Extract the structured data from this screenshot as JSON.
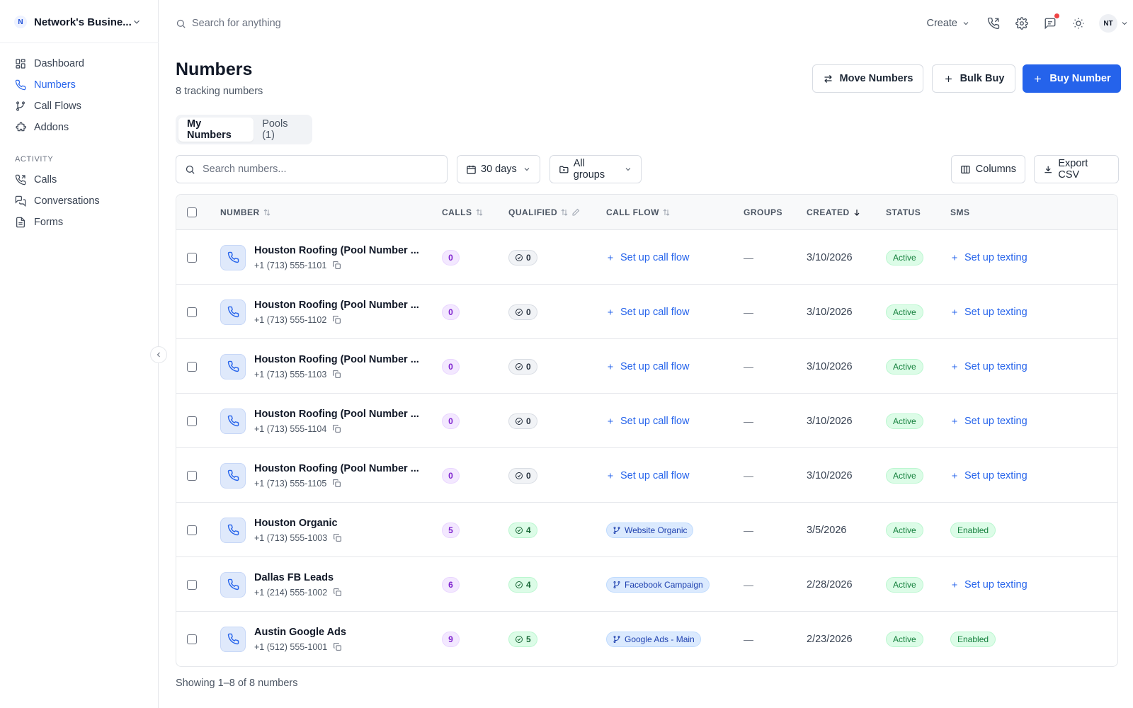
{
  "workspace": {
    "initial": "N",
    "name": "Network's Busine..."
  },
  "sidebar": {
    "items": [
      {
        "label": "Dashboard",
        "icon": "dashboard-icon",
        "active": false
      },
      {
        "label": "Numbers",
        "icon": "phone-icon",
        "active": true
      },
      {
        "label": "Call Flows",
        "icon": "branch-icon",
        "active": false
      },
      {
        "label": "Addons",
        "icon": "puzzle-icon",
        "active": false
      }
    ],
    "activity_heading": "ACTIVITY",
    "activity_items": [
      {
        "label": "Calls",
        "icon": "phone-call-icon"
      },
      {
        "label": "Conversations",
        "icon": "chat-icon"
      },
      {
        "label": "Forms",
        "icon": "document-icon"
      }
    ]
  },
  "topbar": {
    "search_placeholder": "Search for anything",
    "create_label": "Create",
    "user_initials": "NT"
  },
  "page": {
    "title": "Numbers",
    "subtitle": "8 tracking numbers",
    "move_label": "Move Numbers",
    "bulk_label": "Bulk Buy",
    "buy_label": "Buy Number"
  },
  "tabs": [
    {
      "label": "My Numbers",
      "active": true
    },
    {
      "label": "Pools (1)",
      "active": false
    }
  ],
  "filters": {
    "search_placeholder": "Search numbers...",
    "range": "30 days",
    "groups": "All groups",
    "columns_label": "Columns",
    "export_label": "Export CSV"
  },
  "table": {
    "headers": {
      "number": "NUMBER",
      "calls": "CALLS",
      "qualified": "QUALIFIED",
      "call_flow": "CALL FLOW",
      "groups": "GROUPS",
      "created": "CREATED",
      "status": "STATUS",
      "sms": "SMS"
    },
    "rows": [
      {
        "name": "Houston Roofing (Pool Number ...",
        "phone": "+1 (713) 555-1101",
        "calls": "0",
        "qualified": "0",
        "flow": null,
        "flow_action": "Set up call flow",
        "groups": "—",
        "created": "3/10/2026",
        "status": "Active",
        "sms": null,
        "sms_action": "Set up texting"
      },
      {
        "name": "Houston Roofing (Pool Number ...",
        "phone": "+1 (713) 555-1102",
        "calls": "0",
        "qualified": "0",
        "flow": null,
        "flow_action": "Set up call flow",
        "groups": "—",
        "created": "3/10/2026",
        "status": "Active",
        "sms": null,
        "sms_action": "Set up texting"
      },
      {
        "name": "Houston Roofing (Pool Number ...",
        "phone": "+1 (713) 555-1103",
        "calls": "0",
        "qualified": "0",
        "flow": null,
        "flow_action": "Set up call flow",
        "groups": "—",
        "created": "3/10/2026",
        "status": "Active",
        "sms": null,
        "sms_action": "Set up texting"
      },
      {
        "name": "Houston Roofing (Pool Number ...",
        "phone": "+1 (713) 555-1104",
        "calls": "0",
        "qualified": "0",
        "flow": null,
        "flow_action": "Set up call flow",
        "groups": "—",
        "created": "3/10/2026",
        "status": "Active",
        "sms": null,
        "sms_action": "Set up texting"
      },
      {
        "name": "Houston Roofing (Pool Number ...",
        "phone": "+1 (713) 555-1105",
        "calls": "0",
        "qualified": "0",
        "flow": null,
        "flow_action": "Set up call flow",
        "groups": "—",
        "created": "3/10/2026",
        "status": "Active",
        "sms": null,
        "sms_action": "Set up texting"
      },
      {
        "name": "Houston Organic",
        "phone": "+1 (713) 555-1003",
        "calls": "5",
        "qualified": "4",
        "flow": "Website Organic",
        "flow_action": null,
        "groups": "—",
        "created": "3/5/2026",
        "status": "Active",
        "sms": "Enabled",
        "sms_action": null
      },
      {
        "name": "Dallas FB Leads",
        "phone": "+1 (214) 555-1002",
        "calls": "6",
        "qualified": "4",
        "flow": "Facebook Campaign",
        "flow_action": null,
        "groups": "—",
        "created": "2/28/2026",
        "status": "Active",
        "sms": null,
        "sms_action": "Set up texting"
      },
      {
        "name": "Austin Google Ads",
        "phone": "+1 (512) 555-1001",
        "calls": "9",
        "qualified": "5",
        "flow": "Google Ads - Main",
        "flow_action": null,
        "groups": "—",
        "created": "2/23/2026",
        "status": "Active",
        "sms": "Enabled",
        "sms_action": null
      }
    ]
  },
  "footer": {
    "showing": "Showing 1–8 of 8 numbers"
  },
  "colors": {
    "accent": "#2563eb",
    "active_green": "#15803d",
    "calls_purple": "#7e22ce"
  }
}
